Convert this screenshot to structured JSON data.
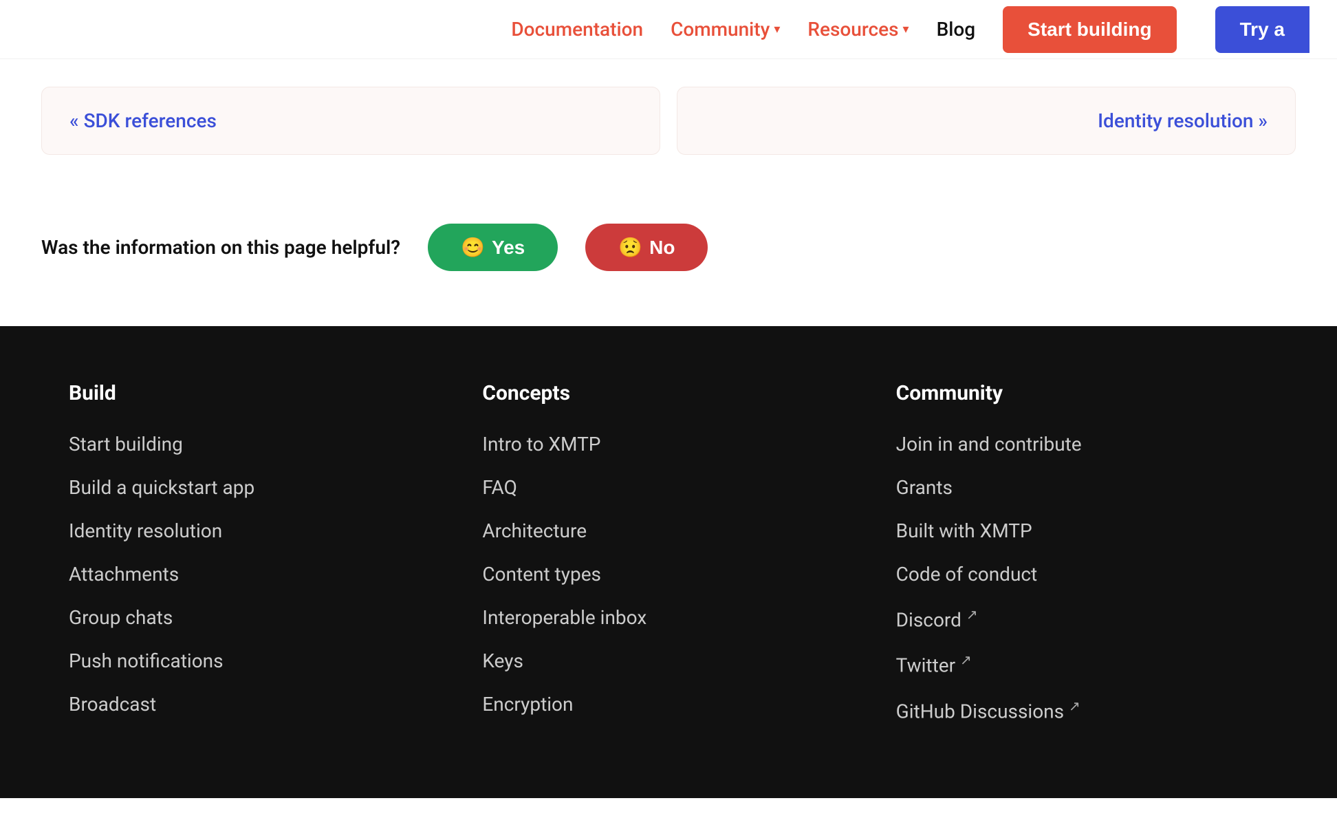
{
  "navbar": {
    "documentation_label": "Documentation",
    "community_label": "Community",
    "resources_label": "Resources",
    "blog_label": "Blog",
    "start_building_label": "Start building",
    "try_label": "Try a"
  },
  "nav_cards": {
    "prev_label": "« SDK references",
    "next_label": "Identity resolution »"
  },
  "feedback": {
    "question": "Was the information on this page helpful?",
    "yes_label": "Yes",
    "no_label": "No",
    "yes_emoji": "😊",
    "no_emoji": "😟"
  },
  "footer": {
    "build": {
      "title": "Build",
      "links": [
        "Start building",
        "Build a quickstart app",
        "Identity resolution",
        "Attachments",
        "Group chats",
        "Push notifications",
        "Broadcast"
      ]
    },
    "concepts": {
      "title": "Concepts",
      "links": [
        "Intro to XMTP",
        "FAQ",
        "Architecture",
        "Content types",
        "Interoperable inbox",
        "Keys",
        "Encryption"
      ]
    },
    "community": {
      "title": "Community",
      "links": [
        "Join in and contribute",
        "Grants",
        "Built with XMTP",
        "Code of conduct",
        "Discord",
        "Twitter",
        "GitHub Discussions"
      ],
      "external_links": [
        "Discord",
        "Twitter",
        "GitHub Discussions"
      ]
    }
  }
}
